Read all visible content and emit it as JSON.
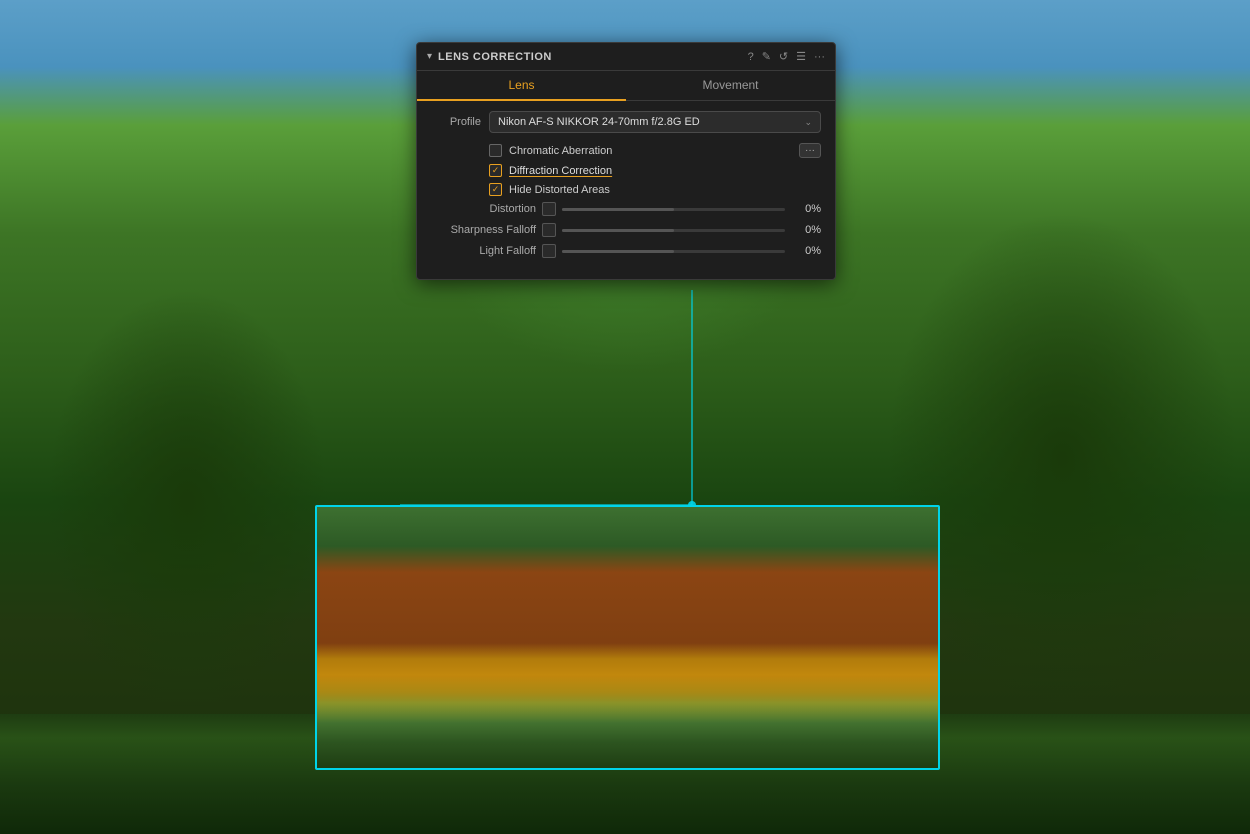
{
  "panel": {
    "title": "LENS CORRECTION",
    "collapse_icon": "▾",
    "icons": [
      "?",
      "✎",
      "⟲",
      "☰",
      "···"
    ]
  },
  "tabs": [
    {
      "label": "Lens",
      "active": true
    },
    {
      "label": "Movement",
      "active": false
    }
  ],
  "profile": {
    "label": "Profile",
    "value": "Nikon AF-S NIKKOR 24-70mm f/2.8G ED"
  },
  "checkboxes": [
    {
      "label": "Chromatic Aberration",
      "checked": false,
      "highlighted": false
    },
    {
      "label": "Diffraction Correction",
      "checked": true,
      "highlighted": true
    },
    {
      "label": "Hide Distorted Areas",
      "checked": true,
      "highlighted": false
    }
  ],
  "sliders": [
    {
      "label": "Distortion",
      "value": "0%",
      "fill": 50
    },
    {
      "label": "Sharpness Falloff",
      "value": "0%",
      "fill": 50
    },
    {
      "label": "Light Falloff",
      "value": "0%",
      "fill": 50
    }
  ],
  "more_btn": "···"
}
